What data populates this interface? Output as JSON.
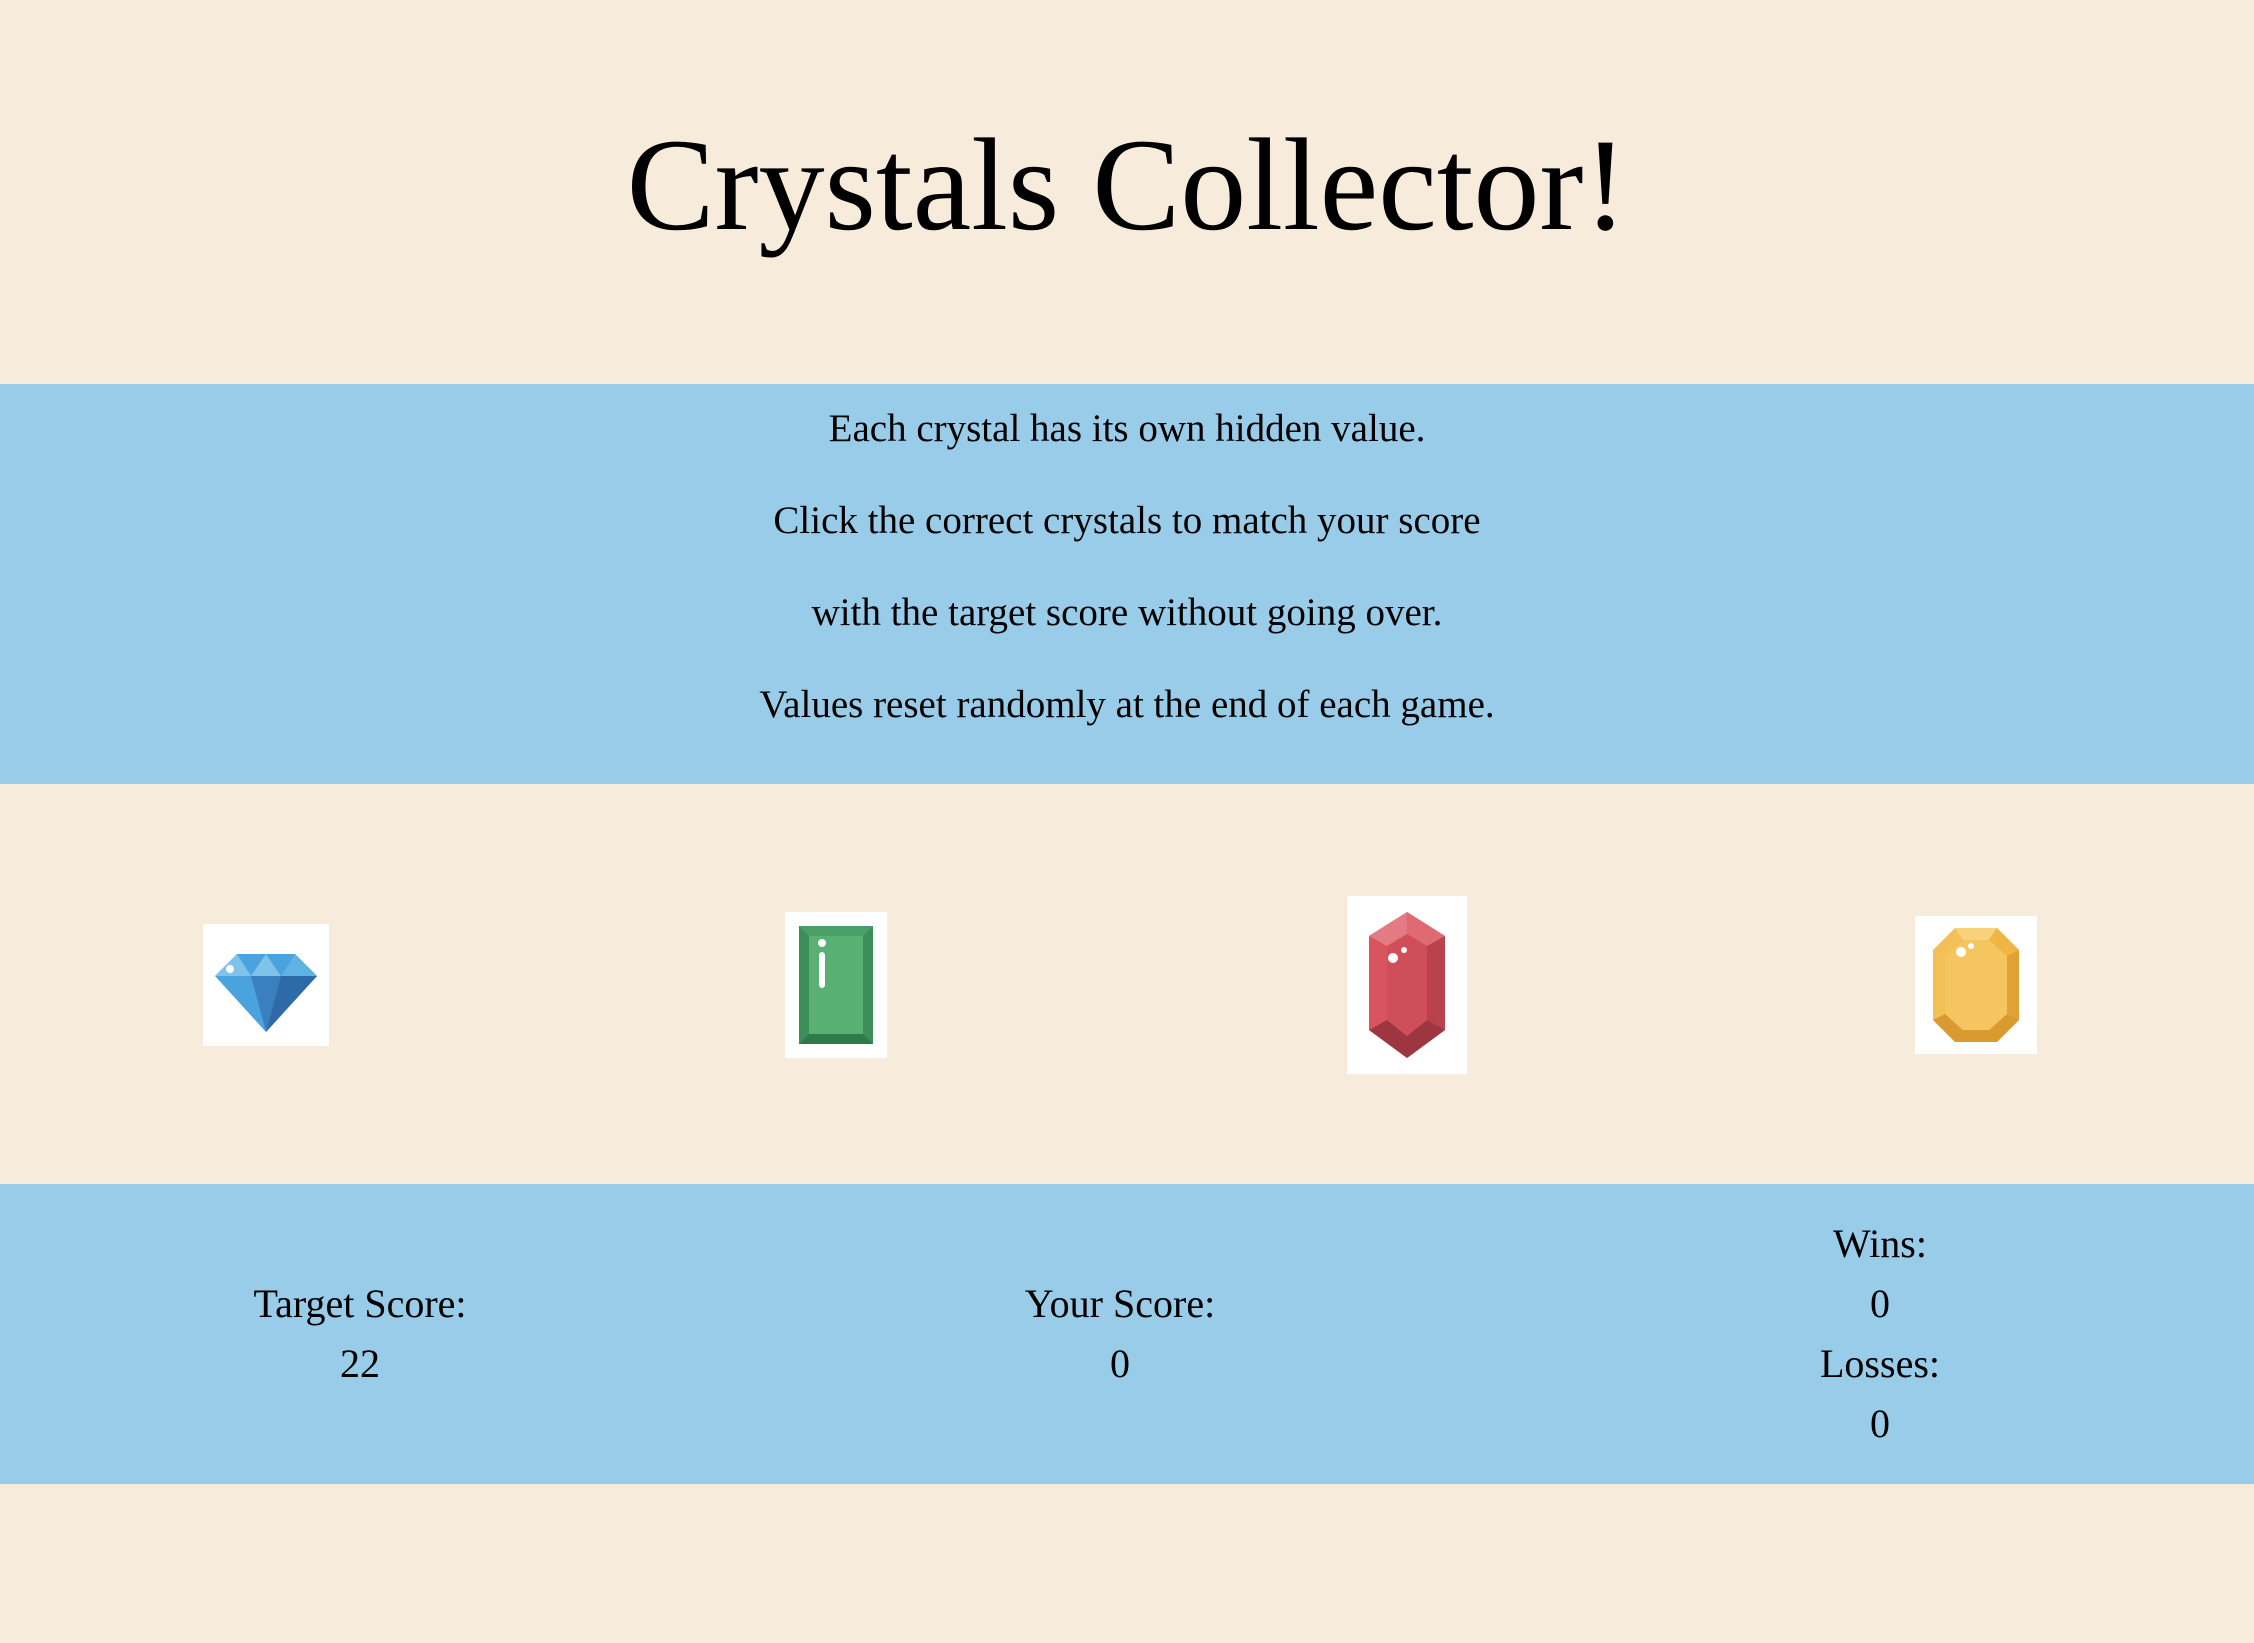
{
  "title": "Crystals Collector!",
  "instructions": [
    "Each crystal has its own hidden value.",
    "Click the correct crystals to match your score",
    "with the target score without going over.",
    "Values reset randomly at the end of each game."
  ],
  "crystals": [
    {
      "name": "blue-diamond-icon",
      "color": "#4aa3df"
    },
    {
      "name": "green-emerald-icon",
      "color": "#58b073"
    },
    {
      "name": "red-ruby-icon",
      "color": "#d8555f"
    },
    {
      "name": "yellow-topaz-icon",
      "color": "#f3c057"
    }
  ],
  "scores": {
    "target_label": "Target Score:",
    "target_value": "22",
    "your_label": "Your Score:",
    "your_value": "0",
    "wins_label": "Wins:",
    "wins_value": "0",
    "losses_label": "Losses:",
    "losses_value": "0"
  },
  "colors": {
    "background": "#f7ecdb",
    "panel": "#99cce8"
  }
}
